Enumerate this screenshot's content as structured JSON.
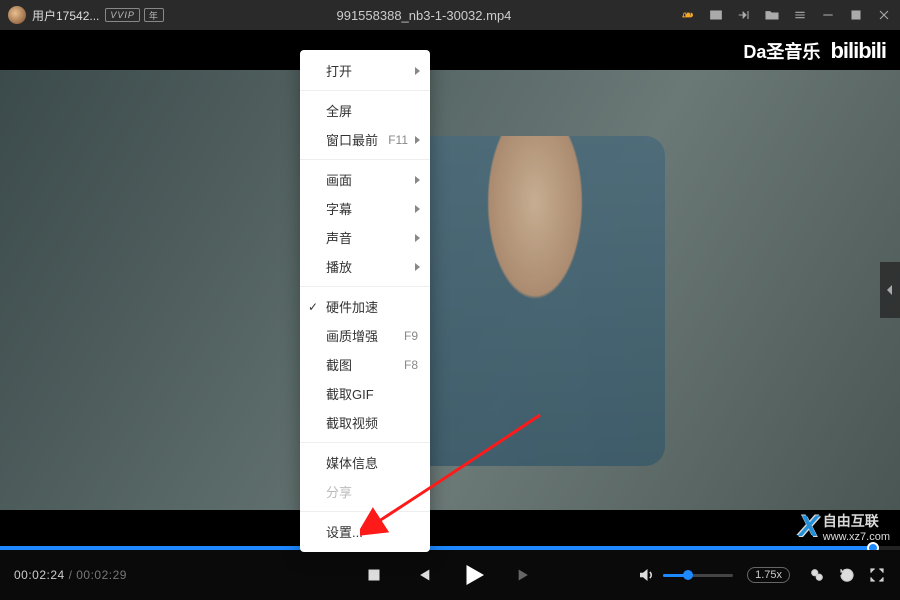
{
  "titlebar": {
    "username": "用户17542...",
    "vip1": "VVIP",
    "vip2": "年",
    "filename": "991558388_nb3-1-30032.mp4"
  },
  "watermark": {
    "channel": "Da圣音乐",
    "site_logo": "bilibili"
  },
  "footer_watermark": {
    "text1": "自由互联",
    "text2": "www.xz7.com"
  },
  "context_menu": {
    "open": "打开",
    "fullscreen": "全屏",
    "always_top": "窗口最前",
    "always_top_key": "F11",
    "picture": "画面",
    "subtitle": "字幕",
    "audio": "声音",
    "playback": "播放",
    "hw_accel": "硬件加速",
    "enhance": "画质增强",
    "enhance_key": "F9",
    "screenshot": "截图",
    "screenshot_key": "F8",
    "gif": "截取GIF",
    "clip": "截取视频",
    "media_info": "媒体信息",
    "share": "分享",
    "settings": "设置..."
  },
  "controls": {
    "current": "00:02:24",
    "total": "00:02:29",
    "speed": "1.75x"
  }
}
